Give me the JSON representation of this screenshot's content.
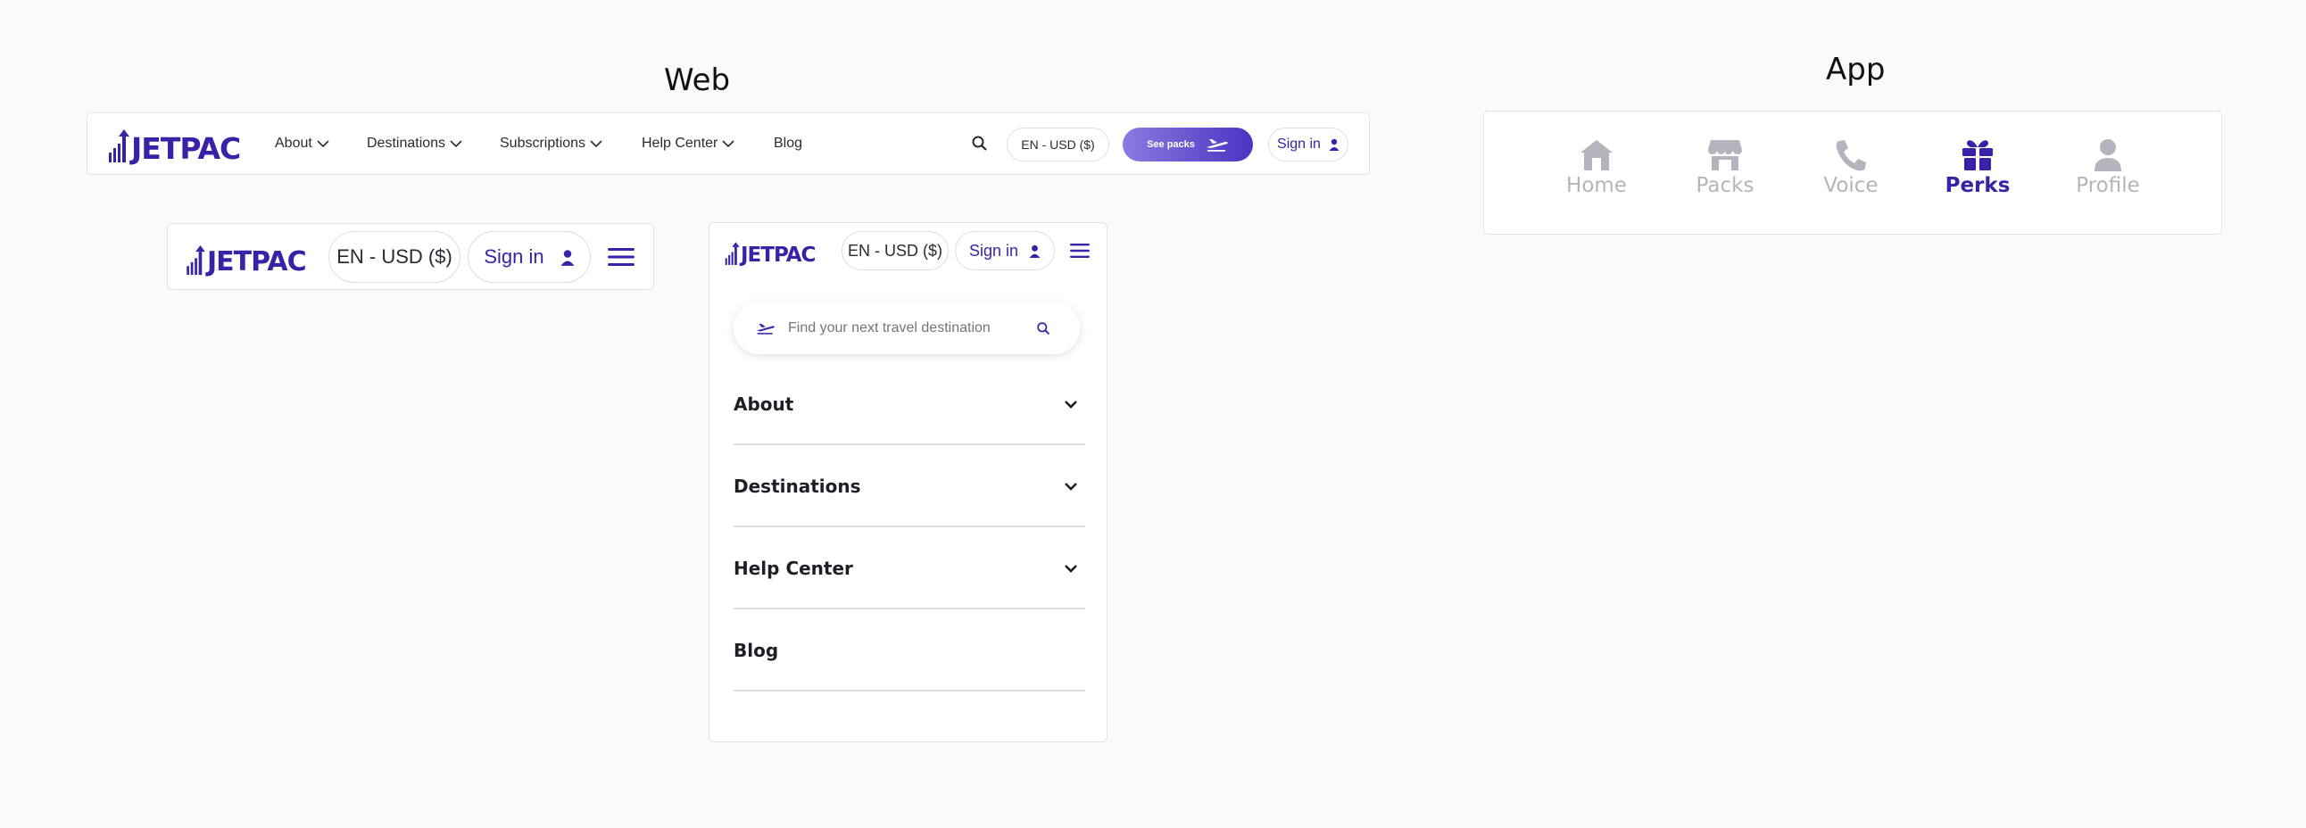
{
  "sections": {
    "web_title": "Web",
    "app_title": "App"
  },
  "brand": {
    "name": "JETPAC",
    "color": "#3a22a8"
  },
  "desktop_nav": {
    "items": [
      {
        "label": "About",
        "has_dropdown": true
      },
      {
        "label": "Destinations",
        "has_dropdown": true
      },
      {
        "label": "Subscriptions",
        "has_dropdown": true
      },
      {
        "label": "Help Center",
        "has_dropdown": true
      },
      {
        "label": "Blog",
        "has_dropdown": false
      }
    ],
    "search_icon": "search-icon",
    "locale": "EN - USD ($)",
    "cta_label": "See packs",
    "cta_icon": "plane-icon",
    "signin_label": "Sign in"
  },
  "tablet_nav": {
    "locale": "EN - USD ($)",
    "signin_label": "Sign in",
    "menu_icon": "hamburger-icon"
  },
  "mobile_menu": {
    "locale": "EN - USD ($)",
    "signin_label": "Sign in",
    "search_placeholder": "Find your next travel destination",
    "items": [
      {
        "label": "About",
        "expandable": true
      },
      {
        "label": "Destinations",
        "expandable": true
      },
      {
        "label": "Help Center",
        "expandable": true
      },
      {
        "label": "Blog",
        "expandable": false
      }
    ]
  },
  "app_tabbar": {
    "tabs": [
      {
        "label": "Home",
        "icon": "home-icon",
        "active": false
      },
      {
        "label": "Packs",
        "icon": "store-icon",
        "active": false
      },
      {
        "label": "Voice",
        "icon": "phone-icon",
        "active": false
      },
      {
        "label": "Perks",
        "icon": "gift-icon",
        "active": true
      },
      {
        "label": "Profile",
        "icon": "profile-icon",
        "active": false
      }
    ],
    "active_color": "#3a22a8",
    "inactive_color": "#b4b4be"
  }
}
